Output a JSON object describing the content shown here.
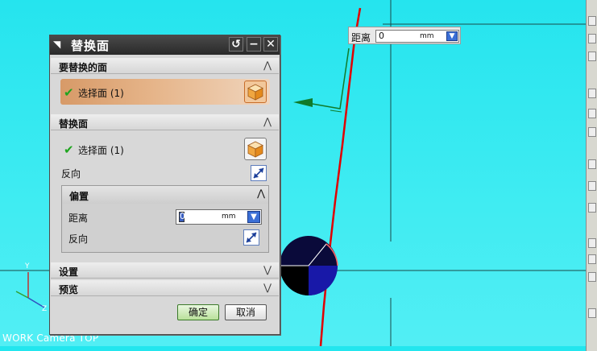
{
  "viewport": {
    "view_label": "WORK Camera TOP",
    "axes": {
      "y": "Y",
      "x": "X",
      "z": "Z"
    }
  },
  "floating_input": {
    "label": "距离",
    "value": "0",
    "unit": "mm"
  },
  "dialog": {
    "title": "替换面",
    "sections": {
      "replace_face": {
        "header": "要替换的面",
        "select_label": "选择面 (1)"
      },
      "replacement_face": {
        "header": "替换面",
        "select_label": "选择面 (1)",
        "reverse_label": "反向"
      },
      "offset": {
        "header": "偏置",
        "distance_label": "距离",
        "distance_value": "0",
        "distance_unit": "mm",
        "reverse_label": "反向"
      },
      "settings": {
        "header": "设置"
      },
      "preview": {
        "header": "预览"
      }
    },
    "buttons": {
      "ok": "确定",
      "cancel": "取消"
    }
  }
}
